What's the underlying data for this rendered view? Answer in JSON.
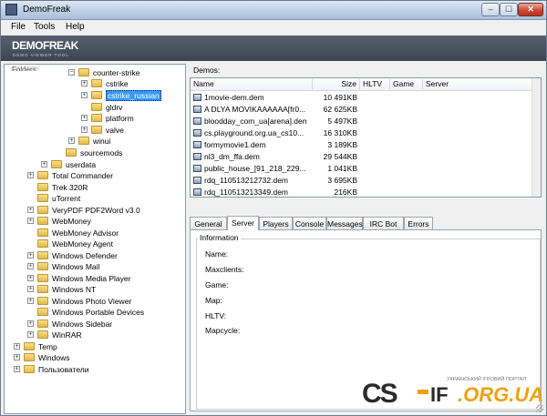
{
  "title": "DemoFreak",
  "window_buttons": {
    "minimize": "–",
    "maximize": "☐",
    "close": "✕"
  },
  "menu": [
    "File",
    "Tools",
    "Help"
  ],
  "banner": {
    "logo": "DEMOFREAK",
    "subtitle": "DEMO VIEWER TOOL"
  },
  "folders_label": "Folders:",
  "tree": [
    {
      "label": "counter-strike",
      "expander": "−"
    },
    {
      "label": "cstrike",
      "expander": "+"
    },
    {
      "label": "cstrike_russian",
      "expander": "+",
      "selected": true
    },
    {
      "label": "gldrv",
      "expander": ""
    },
    {
      "label": "platform",
      "expander": "+"
    },
    {
      "label": "valve",
      "expander": "+"
    },
    {
      "label": "winui",
      "expander": "+"
    },
    {
      "label": "sourcemods",
      "expander": ""
    },
    {
      "label": "userdata",
      "expander": "+"
    },
    {
      "label": "Total Commander",
      "expander": "+"
    },
    {
      "label": "Trek 320R",
      "expander": ""
    },
    {
      "label": "uTorrent",
      "expander": ""
    },
    {
      "label": "VeryPDF PDF2Word v3.0",
      "expander": "+"
    },
    {
      "label": "WebMoney",
      "expander": "+"
    },
    {
      "label": "WebMoney Advisor",
      "expander": ""
    },
    {
      "label": "WebMoney Agent",
      "expander": ""
    },
    {
      "label": "Windows Defender",
      "expander": "+"
    },
    {
      "label": "Windows Mail",
      "expander": "+"
    },
    {
      "label": "Windows Media Player",
      "expander": "+"
    },
    {
      "label": "Windows NT",
      "expander": "+"
    },
    {
      "label": "Windows Photo Viewer",
      "expander": "+"
    },
    {
      "label": "Windows Portable Devices",
      "expander": ""
    },
    {
      "label": "Windows Sidebar",
      "expander": "+"
    },
    {
      "label": "WinRAR",
      "expander": "+"
    },
    {
      "label": "Temp",
      "expander": "+"
    },
    {
      "label": "Windows",
      "expander": "+"
    },
    {
      "label": "Пользователи",
      "expander": "+"
    }
  ],
  "demos_label": "Demos:",
  "columns": [
    "Name",
    "Size",
    "HLTV",
    "Game",
    "Server"
  ],
  "demos": [
    {
      "name": "1movie-dem.dem",
      "size": "10 491KB"
    },
    {
      "name": "A DLYA MOVIKAAAAAA[fr0...",
      "size": "62 625KB"
    },
    {
      "name": "bloodday_com_ua[arena].dem",
      "size": "5 497KB"
    },
    {
      "name": "cs.playground.org.ua_cs10...",
      "size": "16 310KB"
    },
    {
      "name": "formymovie1.dem",
      "size": "3 189KB"
    },
    {
      "name": "nl3_dm_ffa.dem",
      "size": "29 544KB"
    },
    {
      "name": "public_house_[91_218_229...",
      "size": "1 041KB"
    },
    {
      "name": "rdq_110513212732.dem",
      "size": "3 695KB"
    },
    {
      "name": "rdq_110513213349.dem",
      "size": "216KB"
    }
  ],
  "tabs": [
    "General",
    "Server",
    "Players",
    "Console",
    "Messages",
    "IRC Bot",
    "Errors"
  ],
  "active_tab": "Server",
  "info_group_title": "Information",
  "info_fields": [
    "Name:",
    "Maxclients:",
    "Game:",
    "Map:",
    "HLTV:",
    "Mapcycle:"
  ],
  "watermark": {
    "left": "CS",
    "mid": "IF",
    "domain": ".ORG.UA",
    "tagline": "УКРАЇНСЬКИЙ ІГРОВИЙ ПОРТАЛ"
  }
}
